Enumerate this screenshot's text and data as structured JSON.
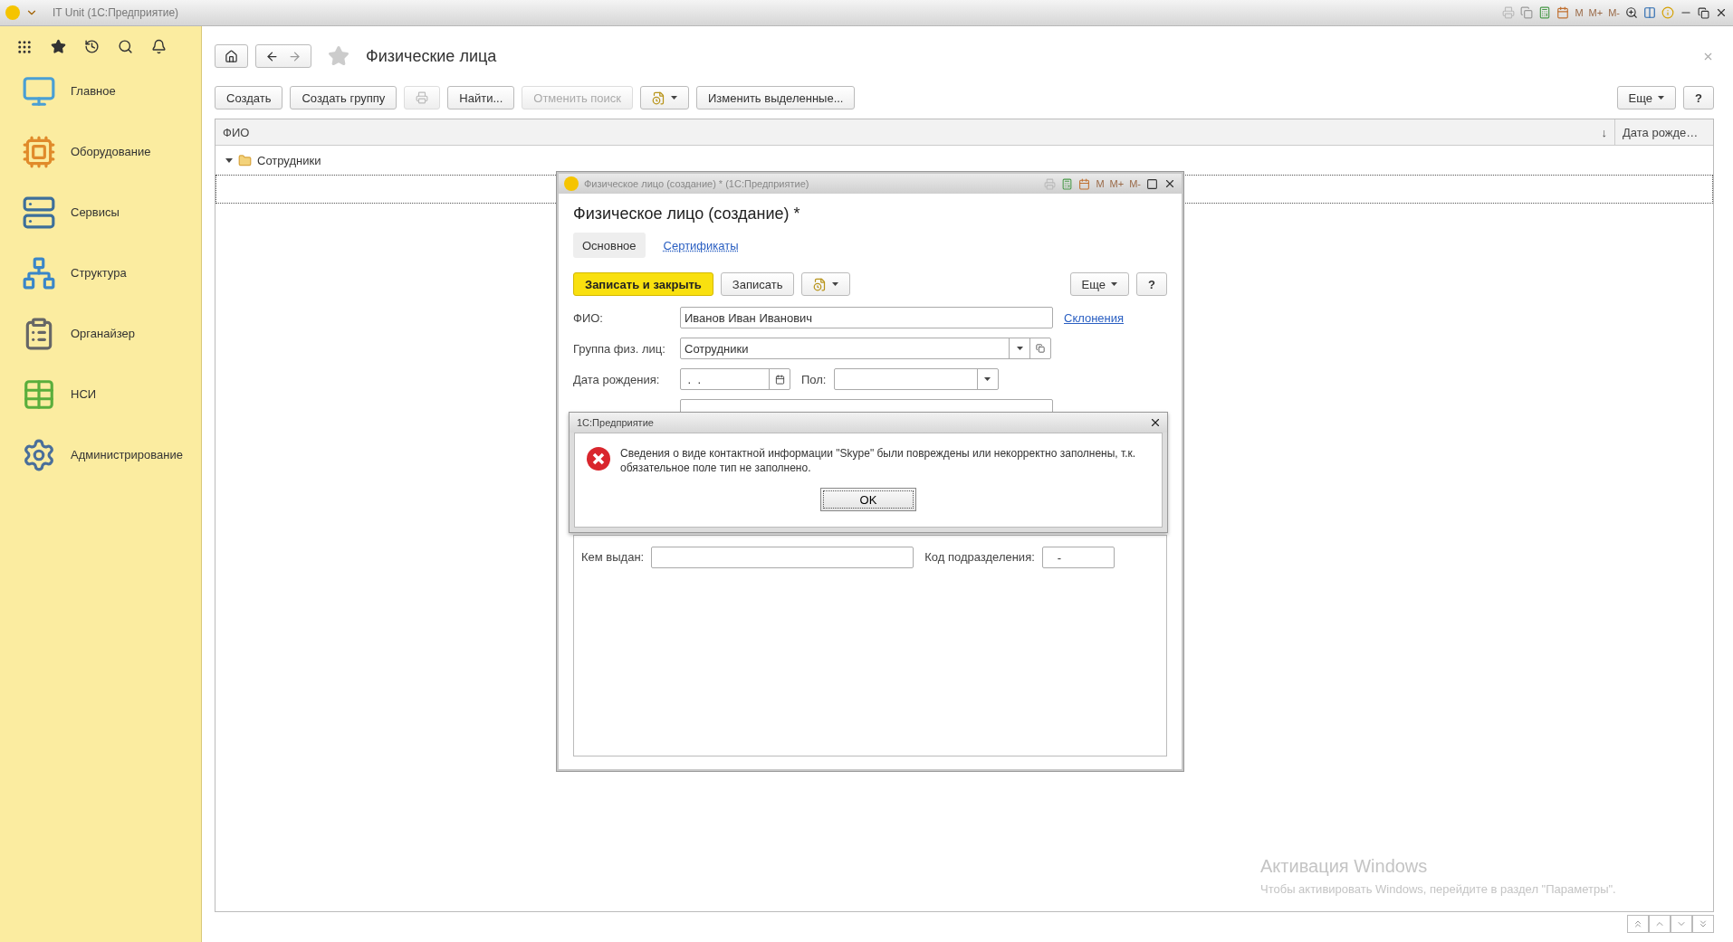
{
  "window": {
    "title": "IT Unit  (1С:Предприятие)",
    "memory_buttons": [
      "M",
      "M+",
      "M-"
    ]
  },
  "sidebar": {
    "items": [
      {
        "label": "Главное",
        "kind": "monitor"
      },
      {
        "label": "Оборудование",
        "kind": "chip"
      },
      {
        "label": "Сервисы",
        "kind": "server"
      },
      {
        "label": "Структура",
        "kind": "structure"
      },
      {
        "label": "Органайзер",
        "kind": "clipboard"
      },
      {
        "label": "НСИ",
        "kind": "table"
      },
      {
        "label": "Администрирование",
        "kind": "gear"
      }
    ]
  },
  "page": {
    "title": "Физические лица",
    "favorite": false
  },
  "toolbar": {
    "buttons": [
      {
        "kind": "text",
        "label": "Создать",
        "disabled": false
      },
      {
        "kind": "text",
        "label": "Создать группу",
        "disabled": false
      },
      {
        "kind": "icon",
        "disabled": true
      },
      {
        "kind": "text",
        "label": "Найти...",
        "disabled": false
      },
      {
        "kind": "text",
        "label": "Отменить поиск",
        "disabled": true
      },
      {
        "kind": "menu",
        "disabled": false
      },
      {
        "kind": "text",
        "label": "Изменить выделенные...",
        "disabled": false
      }
    ],
    "more": "Еще",
    "help": "?"
  },
  "table": {
    "columns": [
      {
        "label": "ФИО",
        "sort": "↓"
      },
      {
        "label": "Дата рожде…"
      }
    ],
    "rows": [
      {
        "kind": "group",
        "label": "Сотрудники",
        "expanded": true,
        "selected": false
      },
      {
        "kind": "new",
        "selected": true
      }
    ]
  },
  "dialog": {
    "window_title": "Физическое лицо (создание) *  (1С:Предприятие)",
    "memory_buttons": [
      "M",
      "M+",
      "M-"
    ],
    "heading": "Физическое лицо (создание) *",
    "tabs": [
      {
        "label": "Основное",
        "selected": true
      },
      {
        "label": "Сертификаты",
        "selected": false
      }
    ],
    "commands": {
      "save_close": "Записать и закрыть",
      "save": "Записать",
      "more": "Еще",
      "help": "?"
    },
    "fio": {
      "label": "ФИО:",
      "value": "Иванов Иван Иванович",
      "link": "Склонения"
    },
    "group": {
      "label": "Группа физ. лиц:",
      "value": "Сотрудники"
    },
    "birth_date": {
      "label": "Дата рождения:",
      "value": " .  ."
    },
    "gender": {
      "label": "Пол:"
    },
    "issued_by": {
      "label": "Кем выдан:"
    },
    "department_code": {
      "label": "Код подразделения:",
      "value": "-"
    }
  },
  "message": {
    "title": "1С:Предприятие",
    "text": "Сведения о виде контактной информации \"Skype\" были повреждены или некорректно заполнены, т.к. обязательное поле тип не заполнено.",
    "button": "OK"
  },
  "activation": {
    "title": "Активация Windows",
    "text": "Чтобы активировать Windows, перейдите в раздел \"Параметры\"."
  }
}
